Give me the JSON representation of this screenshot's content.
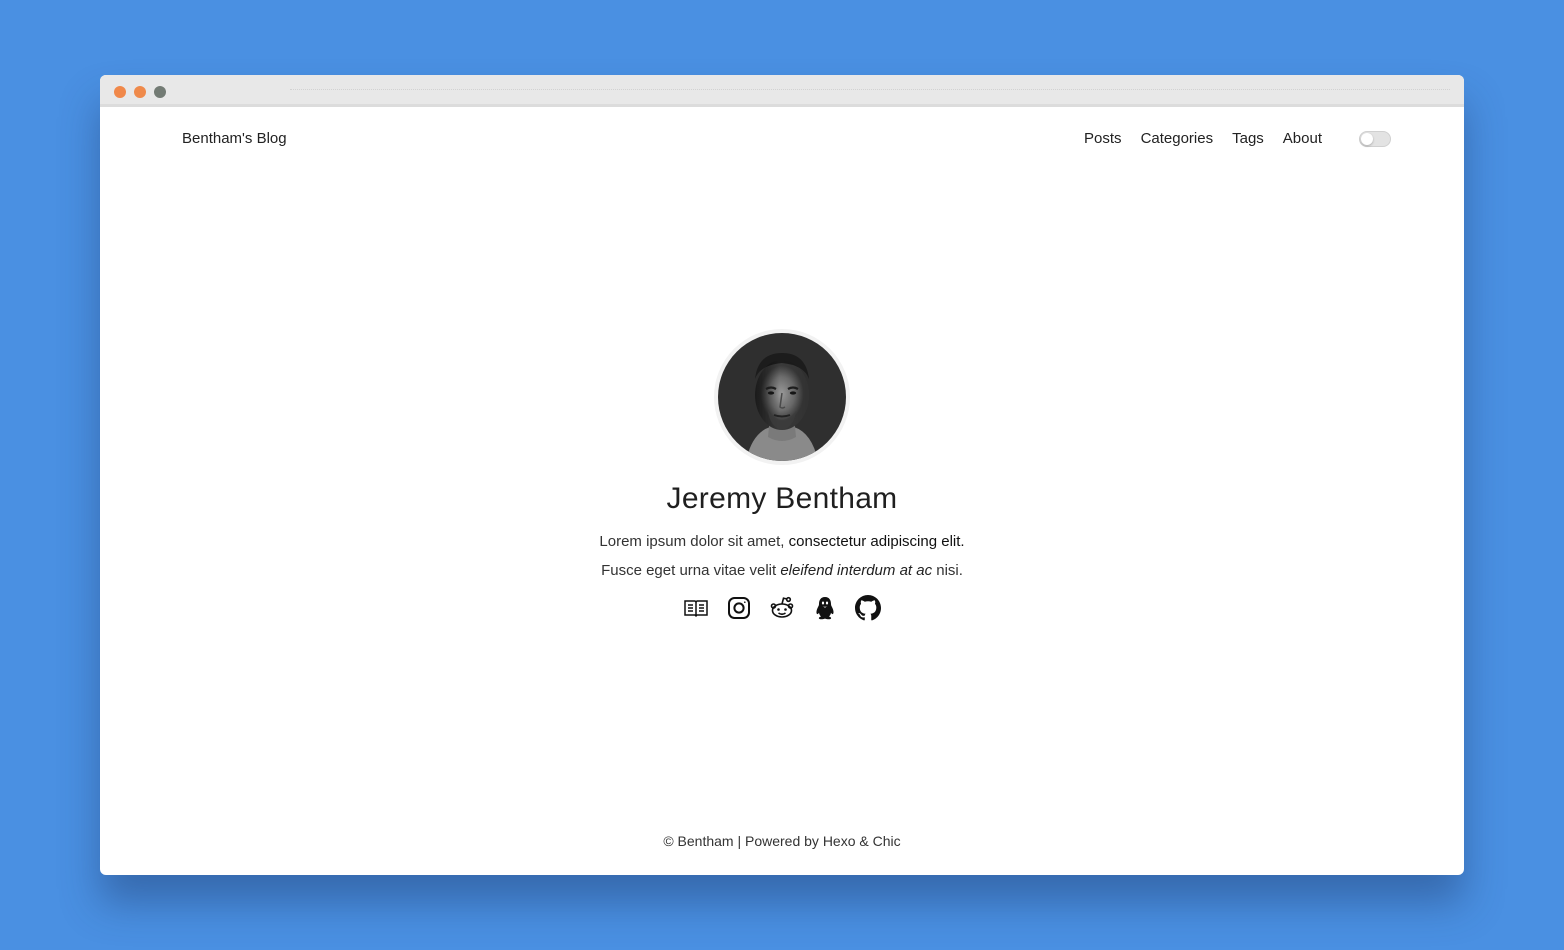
{
  "window": {
    "dots": [
      "red",
      "yellow",
      "green"
    ]
  },
  "nav": {
    "brand": "Bentham's Blog",
    "items": [
      {
        "label": "Posts"
      },
      {
        "label": "Categories"
      },
      {
        "label": "Tags"
      },
      {
        "label": "About"
      }
    ],
    "theme_toggle": {
      "state": "off"
    }
  },
  "profile": {
    "avatar_icon": "portrait-photo",
    "name": "Jeremy Bentham",
    "line1_plain": "Lorem ipsum dolor sit amet, ",
    "line1_strong": "consectetur adipiscing elit.",
    "line2_plain": "Fusce eget urna vitae velit ",
    "line2_em": "eleifend interdum at ac",
    "line2_tail": " nisi.",
    "socials": [
      {
        "icon": "book-icon"
      },
      {
        "icon": "instagram-icon"
      },
      {
        "icon": "reddit-icon"
      },
      {
        "icon": "qq-penguin-icon"
      },
      {
        "icon": "github-icon"
      }
    ]
  },
  "footer": {
    "text": "© Bentham | Powered by Hexo & Chic"
  },
  "colors": {
    "background": "#4a90e2",
    "window": "#ffffff",
    "titlebar": "#e8e8e8",
    "dot_red": "#f0884a",
    "dot_yellow": "#ef8a4b",
    "dot_green": "#737b74"
  }
}
